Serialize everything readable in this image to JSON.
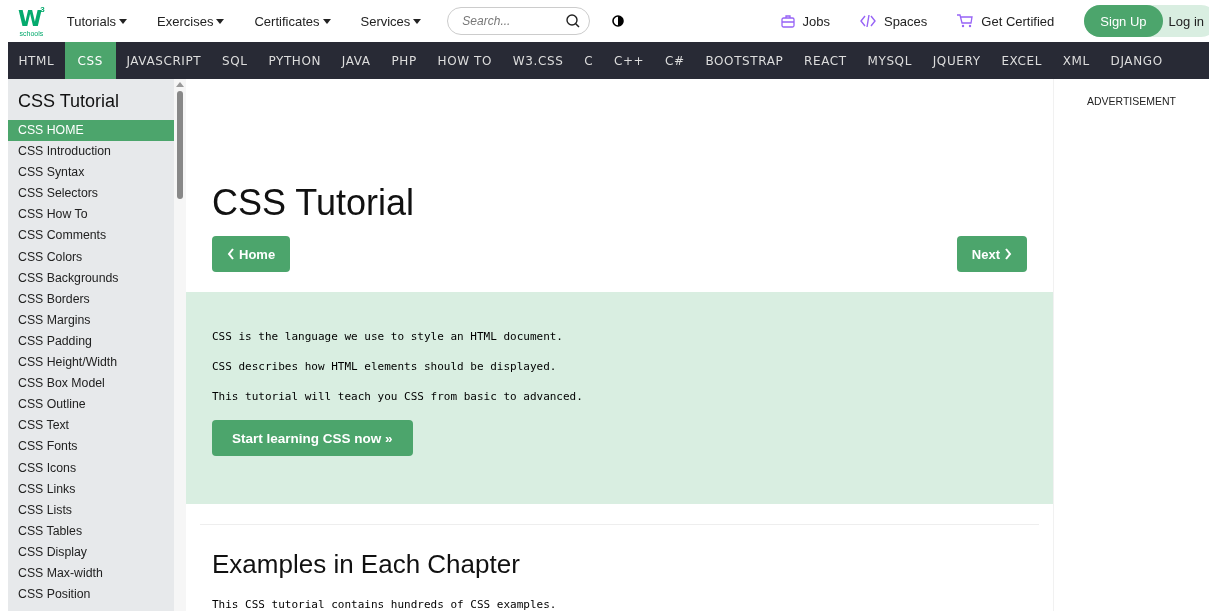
{
  "header": {
    "logo": {
      "mark": "W",
      "sup": "3",
      "sub": "schools"
    },
    "menus": [
      {
        "label": "Tutorials"
      },
      {
        "label": "Exercises"
      },
      {
        "label": "Certificates"
      },
      {
        "label": "Services"
      }
    ],
    "search": {
      "placeholder": "Search..."
    },
    "links": [
      {
        "kind": "jobs",
        "label": "Jobs"
      },
      {
        "kind": "spaces",
        "label": "Spaces"
      },
      {
        "kind": "cart",
        "label": "Get Certified"
      }
    ],
    "signup": "Sign Up",
    "login": "Log in"
  },
  "topnav": [
    {
      "label": "HTML",
      "selected": false
    },
    {
      "label": "CSS",
      "selected": true
    },
    {
      "label": "JAVASCRIPT",
      "selected": false
    },
    {
      "label": "SQL",
      "selected": false
    },
    {
      "label": "PYTHON",
      "selected": false
    },
    {
      "label": "JAVA",
      "selected": false
    },
    {
      "label": "PHP",
      "selected": false
    },
    {
      "label": "HOW TO",
      "selected": false
    },
    {
      "label": "W3.CSS",
      "selected": false
    },
    {
      "label": "C",
      "selected": false
    },
    {
      "label": "C++",
      "selected": false
    },
    {
      "label": "C#",
      "selected": false
    },
    {
      "label": "BOOTSTRAP",
      "selected": false
    },
    {
      "label": "REACT",
      "selected": false
    },
    {
      "label": "MYSQL",
      "selected": false
    },
    {
      "label": "JQUERY",
      "selected": false
    },
    {
      "label": "EXCEL",
      "selected": false
    },
    {
      "label": "XML",
      "selected": false
    },
    {
      "label": "DJANGO",
      "selected": false
    }
  ],
  "sidebar": {
    "title": "CSS Tutorial",
    "items": [
      {
        "label": "CSS HOME",
        "selected": true
      },
      {
        "label": "CSS Introduction",
        "selected": false
      },
      {
        "label": "CSS Syntax",
        "selected": false
      },
      {
        "label": "CSS Selectors",
        "selected": false
      },
      {
        "label": "CSS How To",
        "selected": false
      },
      {
        "label": "CSS Comments",
        "selected": false
      },
      {
        "label": "CSS Colors",
        "selected": false
      },
      {
        "label": "CSS Backgrounds",
        "selected": false
      },
      {
        "label": "CSS Borders",
        "selected": false
      },
      {
        "label": "CSS Margins",
        "selected": false
      },
      {
        "label": "CSS Padding",
        "selected": false
      },
      {
        "label": "CSS Height/Width",
        "selected": false
      },
      {
        "label": "CSS Box Model",
        "selected": false
      },
      {
        "label": "CSS Outline",
        "selected": false
      },
      {
        "label": "CSS Text",
        "selected": false
      },
      {
        "label": "CSS Fonts",
        "selected": false
      },
      {
        "label": "CSS Icons",
        "selected": false
      },
      {
        "label": "CSS Links",
        "selected": false
      },
      {
        "label": "CSS Lists",
        "selected": false
      },
      {
        "label": "CSS Tables",
        "selected": false
      },
      {
        "label": "CSS Display",
        "selected": false
      },
      {
        "label": "CSS Max-width",
        "selected": false
      },
      {
        "label": "CSS Position",
        "selected": false
      }
    ]
  },
  "main": {
    "title": "CSS Tutorial",
    "prev_button": "Home",
    "next_button": "Next",
    "intro": [
      "CSS is the language we use to style an HTML document.",
      "CSS describes how HTML elements should be displayed.",
      "This tutorial will teach you CSS from basic to advanced."
    ],
    "cta": "Start learning CSS now »",
    "section_title": "Examples in Each Chapter",
    "section_text": "This CSS tutorial contains hundreds of CSS examples."
  },
  "ad": {
    "label": "ADVERTISEMENT"
  }
}
